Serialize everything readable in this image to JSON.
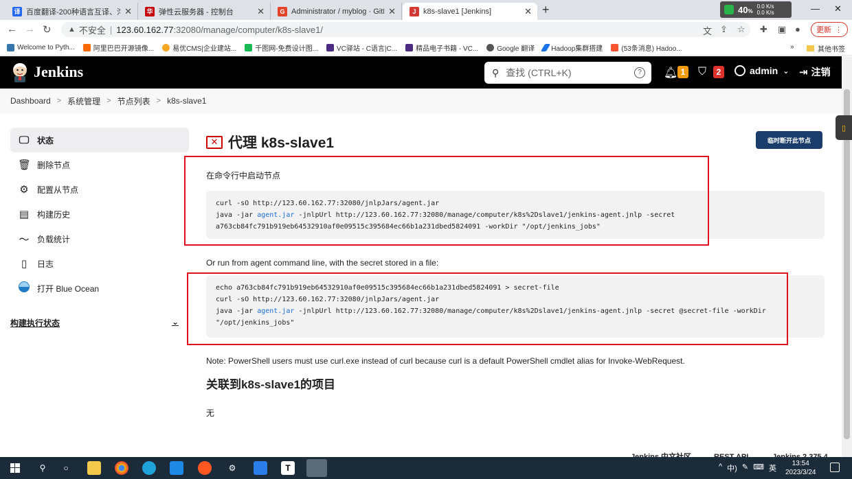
{
  "browser": {
    "tabs": [
      {
        "title": "百度翻译-200种语言互译、沟通",
        "color": "#2468f2",
        "glyph": "译"
      },
      {
        "title": "弹性云服务器 - 控制台",
        "color": "#c7000b",
        "glyph": "华"
      },
      {
        "title": "Administrator / myblog · GitLa",
        "color": "#e24329",
        "glyph": "G"
      },
      {
        "title": "k8s-slave1 [Jenkins]",
        "color": "#d33833",
        "glyph": "J"
      }
    ],
    "new_tab": "+",
    "widget": {
      "num": "40",
      "unit": "%",
      "up": "0.0 K/s",
      "down": "0.0 K/s"
    },
    "address": {
      "security": "不安全",
      "host": "123.60.162.77",
      "path": ":32080/manage/computer/k8s-slave1/"
    },
    "update_label": "更新",
    "bookmarks": [
      {
        "label": "Welcome to Pyth...",
        "color": "#3776ab"
      },
      {
        "label": "阿里巴巴开源镜像...",
        "color": "#ff6a00"
      },
      {
        "label": "易优CMS|企业建站...",
        "color": "#f5a623"
      },
      {
        "label": "千图网-免费设计图...",
        "color": "#19b955"
      },
      {
        "label": "VC驿站 - C语言|C...",
        "color": "#4b2c82"
      },
      {
        "label": "精品电子书籍 - VC...",
        "color": "#4b2c82"
      },
      {
        "label": "Google 翻译",
        "color": "#555555"
      },
      {
        "label": "Hadoop集群搭建",
        "color": "#1a73e8"
      },
      {
        "label": "(53条消息) Hadoo...",
        "color": "#fc5531"
      }
    ],
    "bookmarks_more": "»",
    "bookmarks_other": "其他书签"
  },
  "jenkins": {
    "title": "Jenkins",
    "search_placeholder": "查找 (CTRL+K)",
    "help": "?",
    "notif_count": "1",
    "security_count": "2",
    "user": "admin",
    "logout": "注销"
  },
  "breadcrumb": [
    "Dashboard",
    "系统管理",
    "节点列表",
    "k8s-slave1"
  ],
  "sidebar": {
    "items": [
      {
        "label": "状态",
        "icon": "monitor-icon"
      },
      {
        "label": "删除节点",
        "icon": "trash-icon"
      },
      {
        "label": "配置从节点",
        "icon": "gear-icon"
      },
      {
        "label": "构建历史",
        "icon": "history-icon"
      },
      {
        "label": "负载统计",
        "icon": "chart-icon"
      },
      {
        "label": "日志",
        "icon": "clipboard-icon"
      },
      {
        "label": "打开 Blue Ocean",
        "icon": "blue-ocean-icon"
      }
    ],
    "exec_status": "构建执行状态"
  },
  "main": {
    "title": "代理 k8s-slave1",
    "disconnect_button": "临时断开此节点",
    "run_label": "在命令行中启动节点",
    "code1": {
      "line1": "curl -sO http://123.60.162.77:32080/jnlpJars/agent.jar",
      "line2_pre": "java -jar ",
      "line2_link": "agent.jar",
      "line2_post": " -jnlpUrl http://123.60.162.77:32080/manage/computer/k8s%2Dslave1/jenkins-agent.jnlp -secret",
      "line3": "a763cb84fc791b919eb64532910af0e09515c395684ec66b1a231dbed5824091 -workDir \"/opt/jenkins_jobs\""
    },
    "alt_label": "Or run from agent command line, with the secret stored in a file:",
    "code2": {
      "line1": "echo a763cb84fc791b919eb64532910af0e09515c395684ec66b1a231dbed5824091 > secret-file",
      "line2": "curl -sO http://123.60.162.77:32080/jnlpJars/agent.jar",
      "line3_pre": "java -jar ",
      "line3_link": "agent.jar",
      "line3_post": " -jnlpUrl http://123.60.162.77:32080/manage/computer/k8s%2Dslave1/jenkins-agent.jnlp -secret @secret-file -workDir",
      "line4": "\"/opt/jenkins_jobs\""
    },
    "note": "Note: PowerShell users must use curl.exe instead of curl because curl is a default PowerShell cmdlet alias for Invoke-WebRequest.",
    "related_title": "关联到k8s-slave1的项目",
    "related_none": "无"
  },
  "footer": {
    "community": "Jenkins 中文社区",
    "rest_api": "REST API",
    "version": "Jenkins 2.375.4"
  },
  "taskbar": {
    "tray": [
      "^",
      "中)",
      "英"
    ],
    "time": "13:54",
    "date": "2023/3/24"
  },
  "colors": {
    "jenkins_header": "#000000",
    "annotation_red": "#e01020",
    "primary_button": "#1a3d6b",
    "link": "#1d6fd3"
  }
}
